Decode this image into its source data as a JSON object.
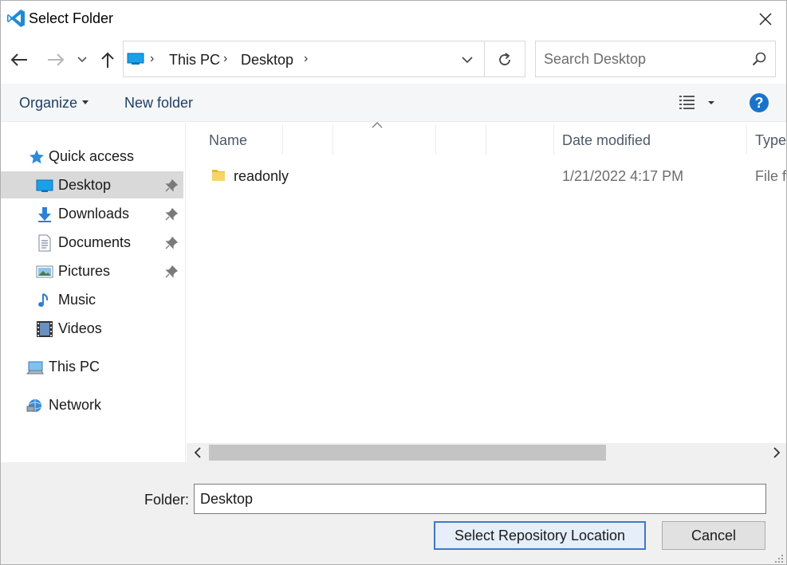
{
  "window": {
    "title": "Select Folder"
  },
  "address": {
    "crumbs": [
      "This PC",
      "Desktop"
    ]
  },
  "search": {
    "placeholder": "Search Desktop"
  },
  "toolbar": {
    "organize": "Organize",
    "new_folder": "New folder",
    "help": "?"
  },
  "nav": {
    "quick_access": "Quick access",
    "items": [
      {
        "label": "Desktop",
        "icon": "desktop-icon",
        "pinned": true,
        "selected": true
      },
      {
        "label": "Downloads",
        "icon": "downloads-icon",
        "pinned": true
      },
      {
        "label": "Documents",
        "icon": "documents-icon",
        "pinned": true
      },
      {
        "label": "Pictures",
        "icon": "pictures-icon",
        "pinned": true
      },
      {
        "label": "Music",
        "icon": "music-icon",
        "pinned": false
      },
      {
        "label": "Videos",
        "icon": "videos-icon",
        "pinned": false
      }
    ],
    "this_pc": "This PC",
    "network": "Network"
  },
  "columns": {
    "name": "Name",
    "date_modified": "Date modified",
    "type": "Type"
  },
  "files": [
    {
      "name": "readonly",
      "date": "1/21/2022 4:17 PM",
      "type": "File fo"
    }
  ],
  "bottom": {
    "folder_label": "Folder:",
    "folder_value": "Desktop",
    "select_button": "Select Repository Location",
    "cancel_button": "Cancel"
  },
  "colors": {
    "accent": "#1a73c9",
    "selected_bg": "#d9d9d9",
    "primary_border": "#3f78c7"
  }
}
